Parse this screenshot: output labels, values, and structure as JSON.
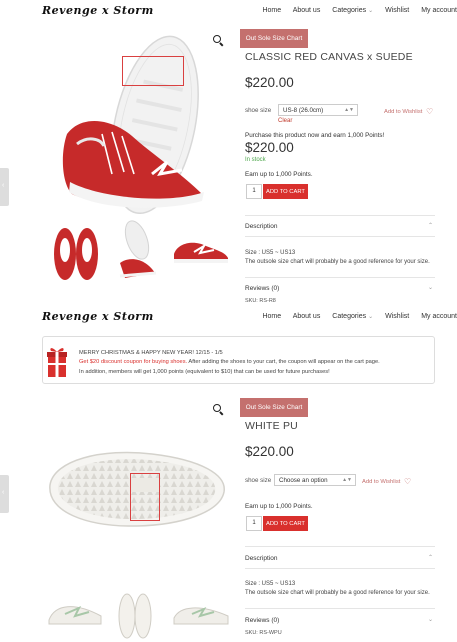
{
  "nav": {
    "logo": "Revenge x Storm",
    "items": [
      "Home",
      "About us",
      "Categories",
      "Wishlist",
      "My account"
    ]
  },
  "product1": {
    "size_chart_button": "Out Sole Size Chart",
    "title": "CLASSIC RED CANVAS x SUEDE",
    "price": "$220.00",
    "size_label": "shoe size",
    "size_value": "US-8 (26.0cm)",
    "clear_label": "Clear",
    "wishlist_label": "Add to Wishlist",
    "points_purchase": "Purchase this product now and earn 1,000 Points!",
    "price2": "$220.00",
    "stock": "In stock",
    "earn_points": "Earn up to 1,000 Points.",
    "qty": "1",
    "add_to_cart": "ADD TO CART",
    "description_label": "Description",
    "size_range": "Size : US5 ~ US13",
    "size_note": "The outsole size chart will probably be a good reference for your size.",
    "reviews_label": "Reviews (0)",
    "sku": "SKU: RS-R8"
  },
  "banner": {
    "line1": "MERRY CHRISTMAS & HAPPY NEW YEAR! 12/15 - 1/5",
    "line2_red": "Get $20 discount coupon for buying shoes.",
    "line2_rest": " After adding the shoes to your cart, the coupon will appear on the cart page.",
    "line3": "In addition, members will get 1,000 points (equivalent to $10) that can be used for future purchases!"
  },
  "product2": {
    "size_chart_button": "Out Sole Size Chart",
    "title": "WHITE PU",
    "price": "$220.00",
    "size_label": "shoe size",
    "size_value": "Choose an option",
    "wishlist_label": "Add to Wishlist",
    "earn_points": "Earn up to 1,000 Points.",
    "qty": "1",
    "add_to_cart": "ADD TO CART",
    "description_label": "Description",
    "size_range": "Size : US5 ~ US13",
    "size_note": "The outsole size chart will probably be a good reference for your size.",
    "reviews_label": "Reviews (0)",
    "sku": "SKU: RS-WPU"
  },
  "icons": {
    "search": "search-icon",
    "heart": "heart-icon",
    "chevron": "chevron-down-icon",
    "gift": "gift-icon"
  },
  "colors": {
    "accent": "#c4706e",
    "cart": "#d9302d",
    "stock": "#4aa548"
  }
}
